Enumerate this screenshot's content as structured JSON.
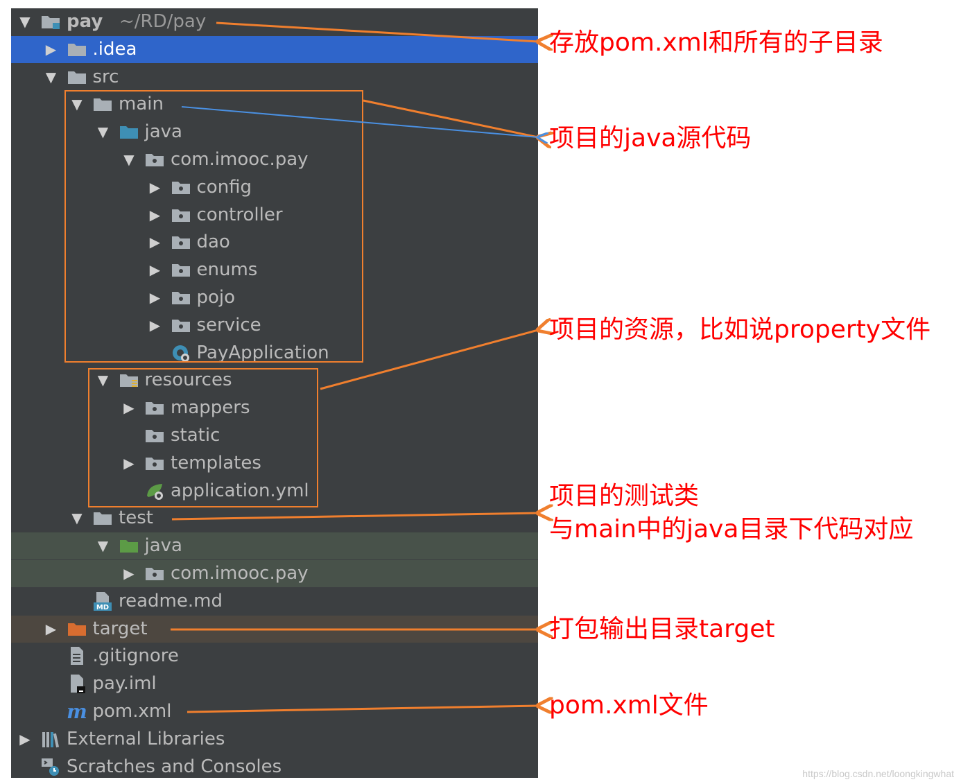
{
  "tree": {
    "rows": [
      {
        "name": "project-root-pay",
        "label": "pay",
        "suffix": "~/RD/pay",
        "arrow": "down",
        "icon": "module-folder-icon"
      },
      {
        "name": "folder-idea",
        "label": ".idea",
        "arrow": "right",
        "icon": "folder-icon",
        "selected": true
      },
      {
        "name": "folder-src",
        "label": "src",
        "arrow": "down",
        "icon": "folder-icon"
      },
      {
        "name": "folder-main",
        "label": "main",
        "arrow": "down",
        "icon": "folder-icon"
      },
      {
        "name": "folder-main-java",
        "label": "java",
        "arrow": "down",
        "icon": "source-folder-icon"
      },
      {
        "name": "package-com-imooc-pay",
        "label": "com.imooc.pay",
        "arrow": "down",
        "icon": "package-icon"
      },
      {
        "name": "package-config",
        "label": "config",
        "arrow": "right",
        "icon": "package-icon"
      },
      {
        "name": "package-controller",
        "label": "controller",
        "arrow": "right",
        "icon": "package-icon"
      },
      {
        "name": "package-dao",
        "label": "dao",
        "arrow": "right",
        "icon": "package-icon"
      },
      {
        "name": "package-enums",
        "label": "enums",
        "arrow": "right",
        "icon": "package-icon"
      },
      {
        "name": "package-pojo",
        "label": "pojo",
        "arrow": "right",
        "icon": "package-icon"
      },
      {
        "name": "package-service",
        "label": "service",
        "arrow": "right",
        "icon": "package-icon"
      },
      {
        "name": "file-pay-application",
        "label": "PayApplication",
        "arrow": "none",
        "icon": "spring-boot-class-icon"
      },
      {
        "name": "folder-resources",
        "label": "resources",
        "arrow": "down",
        "icon": "resources-folder-icon"
      },
      {
        "name": "folder-mappers",
        "label": "mappers",
        "arrow": "right",
        "icon": "package-icon"
      },
      {
        "name": "folder-static",
        "label": "static",
        "arrow": "none",
        "icon": "package-icon"
      },
      {
        "name": "folder-templates",
        "label": "templates",
        "arrow": "right",
        "icon": "package-icon"
      },
      {
        "name": "file-application-yml",
        "label": "application.yml",
        "arrow": "none",
        "icon": "spring-config-icon"
      },
      {
        "name": "folder-test",
        "label": "test",
        "arrow": "down",
        "icon": "folder-icon"
      },
      {
        "name": "folder-test-java",
        "label": "java",
        "arrow": "down",
        "icon": "test-folder-icon",
        "bg": "test"
      },
      {
        "name": "package-test-com-imooc-pay",
        "label": "com.imooc.pay",
        "arrow": "right",
        "icon": "package-icon",
        "bg": "test"
      },
      {
        "name": "file-readme-md",
        "label": "readme.md",
        "arrow": "none",
        "icon": "markdown-file-icon"
      },
      {
        "name": "folder-target",
        "label": "target",
        "arrow": "right",
        "icon": "excluded-folder-icon",
        "bg": "target"
      },
      {
        "name": "file-gitignore",
        "label": ".gitignore",
        "arrow": "none",
        "icon": "text-file-icon"
      },
      {
        "name": "file-pay-iml",
        "label": "pay.iml",
        "arrow": "none",
        "icon": "iml-file-icon"
      },
      {
        "name": "file-pom-xml",
        "label": "pom.xml",
        "arrow": "none",
        "icon": "maven-icon"
      },
      {
        "name": "node-external-libraries",
        "label": "External Libraries",
        "arrow": "right",
        "icon": "libraries-icon"
      },
      {
        "name": "node-scratches-consoles",
        "label": "Scratches and Consoles",
        "arrow": "none",
        "icon": "scratches-icon"
      }
    ]
  },
  "annotations": {
    "root_note": "存放pom.xml和所有的子目录",
    "java_note": "项目的java源代码",
    "resources_note": "项目的资源，比如说property文件",
    "test_note_line1": "项目的测试类",
    "test_note_line2": "与main中的java目录下代码对应",
    "target_note": "打包输出目录target",
    "pom_note": "pom.xml文件"
  },
  "watermark": "https://blog.csdn.net/loongkingwhat",
  "colors": {
    "panel": "#3c3f41",
    "selection": "#2f65ca",
    "annotation_text": "#ff0000",
    "orange_arrow": "#f07f2e",
    "blue_arrow": "#4a90e2",
    "folder_gray": "#a9b0b6",
    "source_blue": "#3e8fb5",
    "test_green": "#5c9b46",
    "excluded_orange": "#d86d30"
  }
}
